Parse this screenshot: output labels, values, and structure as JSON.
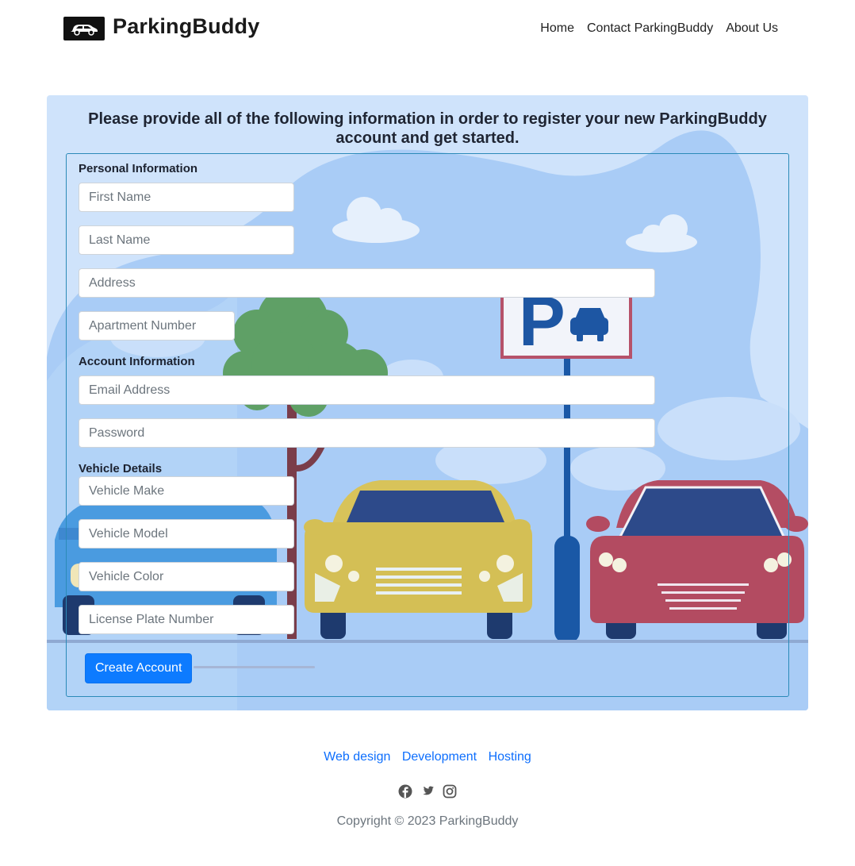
{
  "header": {
    "brand": "ParkingBuddy",
    "logo_icon": "car-icon",
    "nav": [
      "Home",
      "Contact ParkingBuddy",
      "About Us"
    ]
  },
  "main": {
    "intro": "Please provide all of the following information in order to register your new ParkingBuddy account and get started.",
    "sections": {
      "personal": "Personal Information",
      "account": "Account Information",
      "vehicle": "Vehicle Details"
    },
    "fields": {
      "first_name": {
        "value": "",
        "placeholder": "First Name"
      },
      "last_name": {
        "value": "",
        "placeholder": "Last Name"
      },
      "address": {
        "value": "",
        "placeholder": "Address"
      },
      "apartment": {
        "value": "",
        "placeholder": "Apartment Number"
      },
      "email": {
        "value": "",
        "placeholder": "Email Address"
      },
      "password": {
        "value": "",
        "placeholder": "Password"
      },
      "vehicle_make": {
        "value": "",
        "placeholder": "Vehicle Make"
      },
      "vehicle_model": {
        "value": "",
        "placeholder": "Vehicle Model"
      },
      "vehicle_color": {
        "value": "",
        "placeholder": "Vehicle Color"
      },
      "license_plate": {
        "value": "",
        "placeholder": "License Plate Number"
      }
    },
    "submit_label": "Create Account",
    "background_illustration": "parking-lot-illustration",
    "sign_letter": "P"
  },
  "footer": {
    "links": [
      "Web design",
      "Development",
      "Hosting"
    ],
    "social_icons": [
      "facebook-icon",
      "twitter-icon",
      "instagram-icon"
    ],
    "copyright": "Copyright © 2023 ParkingBuddy"
  },
  "colors": {
    "panel_bg": "#cfe3fb",
    "primary_button": "#0d7bff",
    "link": "#0d6efd",
    "form_border": "#2b8ab8"
  }
}
